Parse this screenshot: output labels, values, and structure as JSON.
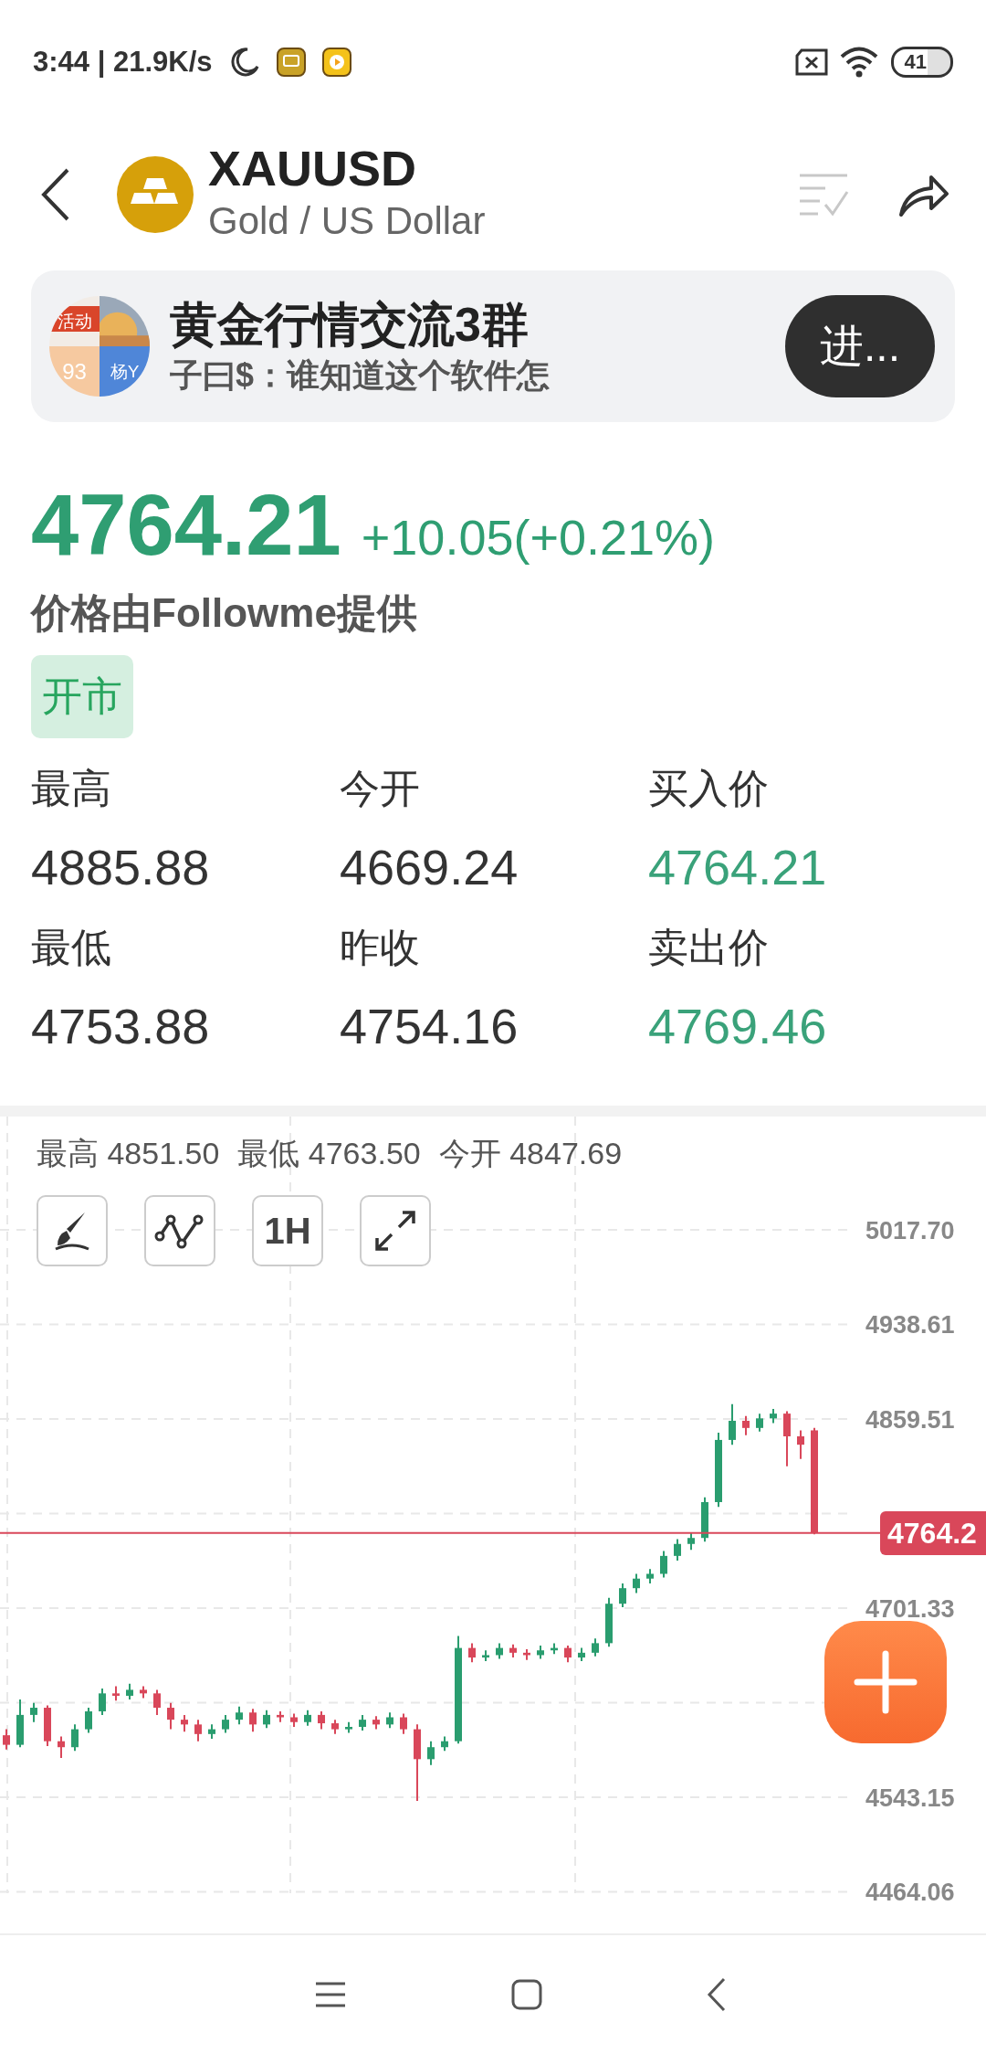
{
  "status_bar": {
    "time": "3:44 | 21.9K/s",
    "battery": "41"
  },
  "header": {
    "symbol": "XAUUSD",
    "name": "Gold / US Dollar"
  },
  "group_banner": {
    "avatar": [
      "活动",
      "93",
      "杨Y"
    ],
    "title": "黄金行情交流3群",
    "message": "子曰$：谁知道这个软件怎",
    "button": "进..."
  },
  "quote": {
    "price": "4764.21",
    "change": "+10.05(+0.21%)",
    "source": "价格由Followme提供",
    "market_status": "开市"
  },
  "stats": [
    {
      "label": "最高",
      "value": "4885.88",
      "kind": "plain"
    },
    {
      "label": "今开",
      "value": "4669.24",
      "kind": "plain"
    },
    {
      "label": "买入价",
      "value": "4764.21",
      "kind": "quote"
    },
    {
      "label": "最低",
      "value": "4753.88",
      "kind": "plain"
    },
    {
      "label": "昨收",
      "value": "4754.16",
      "kind": "plain"
    },
    {
      "label": "卖出价",
      "value": "4769.46",
      "kind": "quote"
    }
  ],
  "chart": {
    "summary": [
      {
        "label": "最高",
        "value": "4851.50"
      },
      {
        "label": "最低",
        "value": "4763.50"
      },
      {
        "label": "今开",
        "value": "4847.69"
      }
    ],
    "tools": [
      {
        "kind": "draw"
      },
      {
        "kind": "indicator"
      },
      {
        "kind": "interval",
        "label": "1H"
      },
      {
        "kind": "fullscreen"
      }
    ],
    "chart_data": {
      "type": "candlestick",
      "grid": true,
      "ylim": [
        4462.9,
        5112.46
      ],
      "ref_lines": [
        {
          "axis": "y",
          "value": 4764.21,
          "color": "#d9475a"
        }
      ],
      "ohlc": [
        [
          4595,
          4600,
          4583,
          4587
        ],
        [
          4587,
          4625,
          4585,
          4612
        ],
        [
          4612,
          4622,
          4606,
          4618
        ],
        [
          4618,
          4620,
          4586,
          4590
        ],
        [
          4590,
          4594,
          4576,
          4585
        ],
        [
          4585,
          4604,
          4582,
          4600
        ],
        [
          4600,
          4618,
          4597,
          4615
        ],
        [
          4615,
          4634,
          4612,
          4630
        ],
        [
          4630,
          4636,
          4624,
          4628
        ],
        [
          4628,
          4638,
          4625,
          4633
        ],
        [
          4633,
          4636,
          4626,
          4630
        ],
        [
          4630,
          4633,
          4612,
          4618
        ],
        [
          4618,
          4622,
          4600,
          4608
        ],
        [
          4608,
          4612,
          4598,
          4604
        ],
        [
          4604,
          4608,
          4590,
          4596
        ],
        [
          4596,
          4604,
          4592,
          4600
        ],
        [
          4600,
          4612,
          4597,
          4608
        ],
        [
          4608,
          4619,
          4604,
          4614
        ],
        [
          4614,
          4617,
          4598,
          4604
        ],
        [
          4604,
          4616,
          4601,
          4612
        ],
        [
          4612,
          4615,
          4606,
          4610
        ],
        [
          4610,
          4613,
          4602,
          4606
        ],
        [
          4606,
          4616,
          4603,
          4612
        ],
        [
          4612,
          4615,
          4600,
          4605
        ],
        [
          4605,
          4608,
          4596,
          4600
        ],
        [
          4600,
          4606,
          4597,
          4602
        ],
        [
          4602,
          4612,
          4599,
          4608
        ],
        [
          4608,
          4611,
          4600,
          4604
        ],
        [
          4604,
          4614,
          4601,
          4610
        ],
        [
          4610,
          4613,
          4596,
          4600
        ],
        [
          4600,
          4604,
          4540,
          4575
        ],
        [
          4575,
          4590,
          4570,
          4585
        ],
        [
          4585,
          4594,
          4582,
          4590
        ],
        [
          4590,
          4678,
          4588,
          4668
        ],
        [
          4668,
          4672,
          4656,
          4660
        ],
        [
          4660,
          4666,
          4657,
          4662
        ],
        [
          4662,
          4672,
          4659,
          4668
        ],
        [
          4668,
          4671,
          4660,
          4664
        ],
        [
          4664,
          4667,
          4658,
          4662
        ],
        [
          4662,
          4670,
          4659,
          4666
        ],
        [
          4666,
          4672,
          4663,
          4668
        ],
        [
          4668,
          4670,
          4656,
          4660
        ],
        [
          4660,
          4668,
          4657,
          4664
        ],
        [
          4664,
          4676,
          4661,
          4672
        ],
        [
          4672,
          4710,
          4669,
          4705
        ],
        [
          4705,
          4722,
          4702,
          4718
        ],
        [
          4718,
          4730,
          4714,
          4726
        ],
        [
          4726,
          4734,
          4722,
          4730
        ],
        [
          4730,
          4749,
          4727,
          4745
        ],
        [
          4745,
          4759,
          4741,
          4755
        ],
        [
          4755,
          4764,
          4750,
          4760
        ],
        [
          4760,
          4794,
          4757,
          4790
        ],
        [
          4790,
          4848,
          4786,
          4842
        ],
        [
          4842,
          4872,
          4838,
          4858
        ],
        [
          4858,
          4862,
          4846,
          4852
        ],
        [
          4852,
          4864,
          4849,
          4860
        ],
        [
          4860,
          4868,
          4856,
          4864
        ],
        [
          4864,
          4866,
          4820,
          4845
        ],
        [
          4845,
          4850,
          4826,
          4838
        ],
        [
          4850,
          4852,
          4763,
          4764
        ]
      ],
      "yticks": [
        {
          "value": 5017.7,
          "label": "5017.70"
        },
        {
          "value": 4938.61,
          "label": "4938.61"
        },
        {
          "value": 4859.51,
          "label": "4859.51"
        },
        {
          "value": 4701.33,
          "label": "4701.33"
        },
        {
          "value": 4543.15,
          "label": "4543.15"
        },
        {
          "value": 4464.06,
          "label": "4464.06"
        }
      ]
    },
    "last_price": "4764.2"
  }
}
